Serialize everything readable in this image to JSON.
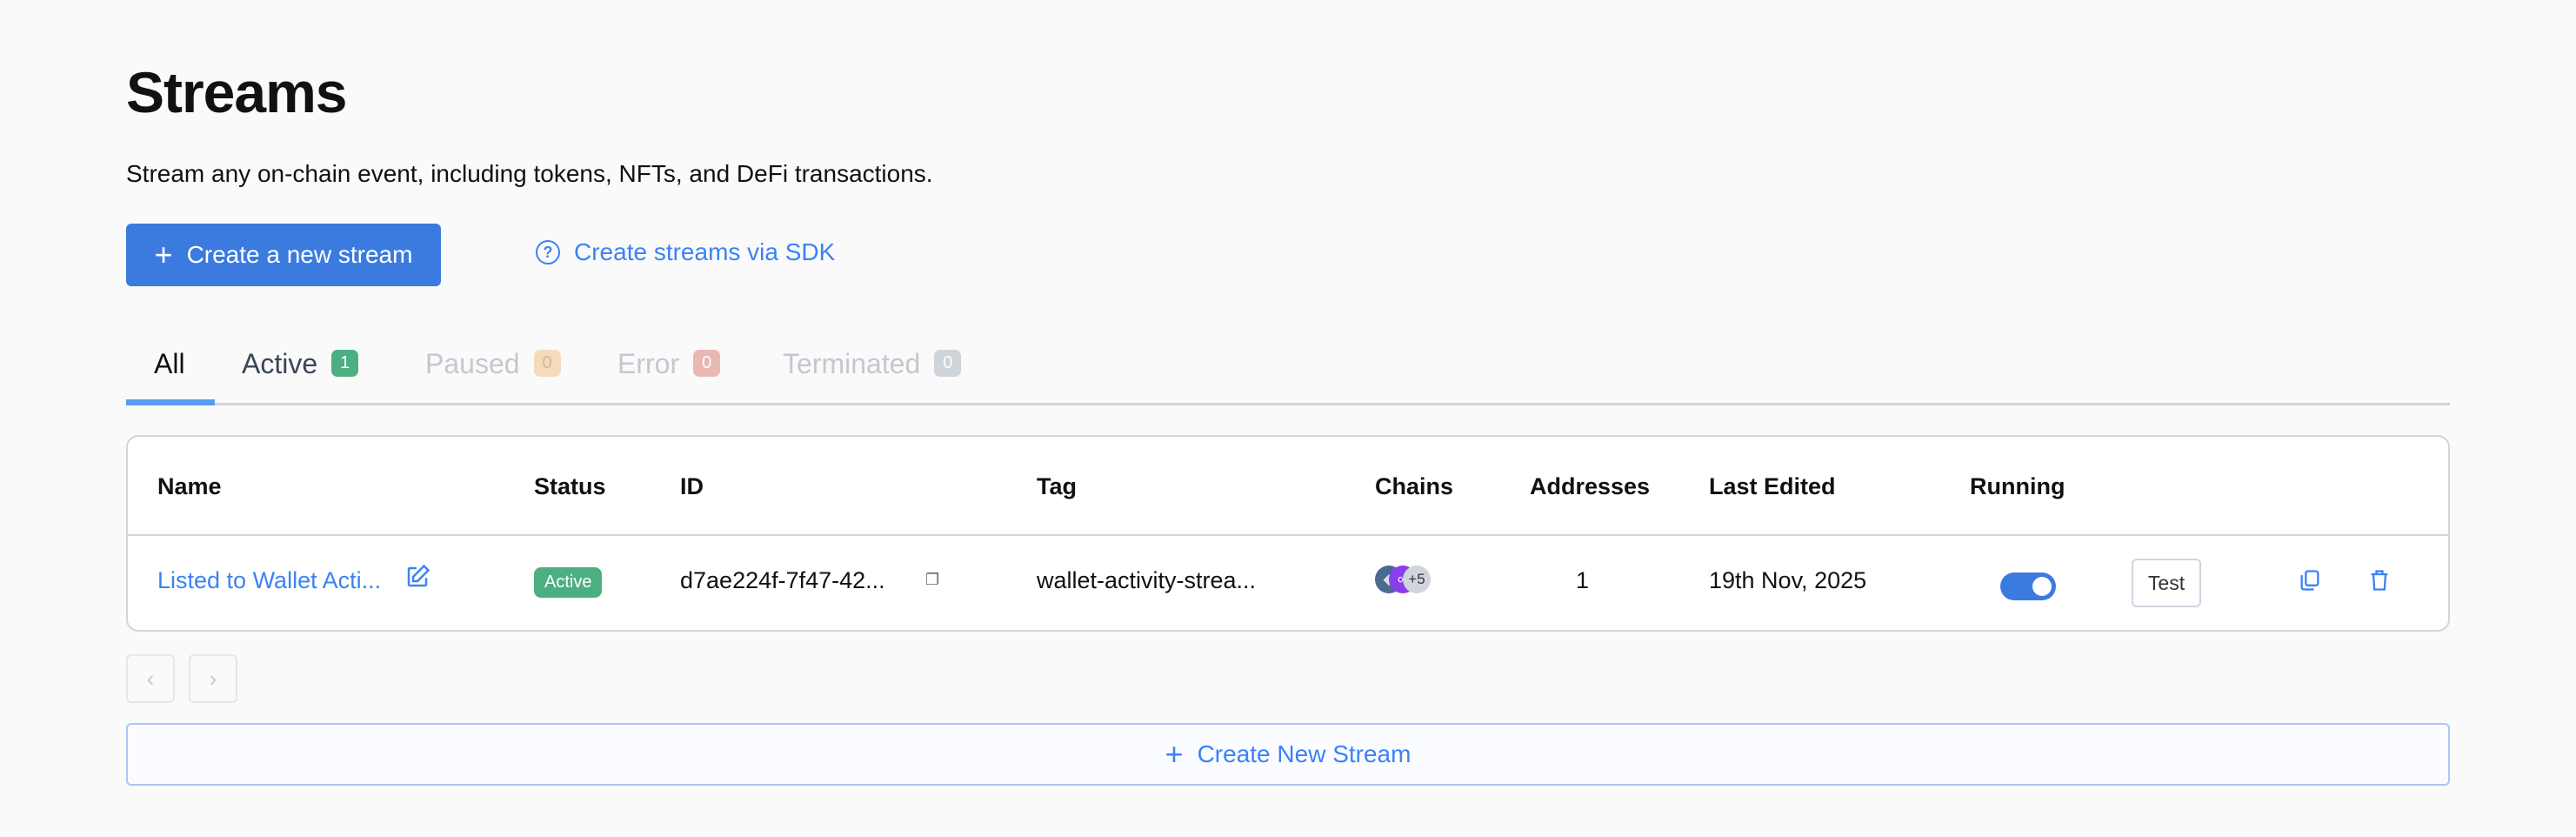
{
  "page": {
    "title": "Streams",
    "subtitle": "Stream any on-chain event, including tokens, NFTs, and DeFi transactions."
  },
  "actions": {
    "create_label": "Create a new stream",
    "sdk_label": "Create streams via SDK",
    "new_stream_label": "Create New Stream"
  },
  "tabs": [
    {
      "label": "All"
    },
    {
      "label": "Active",
      "count": "1",
      "color": "#4caf82"
    },
    {
      "label": "Paused",
      "count": "0",
      "color": "#f3dcbb"
    },
    {
      "label": "Error",
      "count": "0",
      "color": "#e9b8b3"
    },
    {
      "label": "Terminated",
      "count": "0",
      "color": "#cfd4db"
    }
  ],
  "table": {
    "headers": [
      "Name",
      "Status",
      "ID",
      "Tag",
      "Chains",
      "Addresses",
      "Last Edited",
      "Running"
    ],
    "rows": [
      {
        "name": "Listed to Wallet Acti...",
        "status": "Active",
        "id": "d7ae224f-7f47-42...",
        "tag": "wallet-activity-strea...",
        "chains_more": "+5",
        "addresses": "1",
        "last_edited": "19th Nov, 2025",
        "running": true,
        "test_label": "Test"
      }
    ]
  },
  "colors": {
    "accent": "#3b7be0",
    "link": "#3b82f6",
    "active": "#4caf82"
  }
}
